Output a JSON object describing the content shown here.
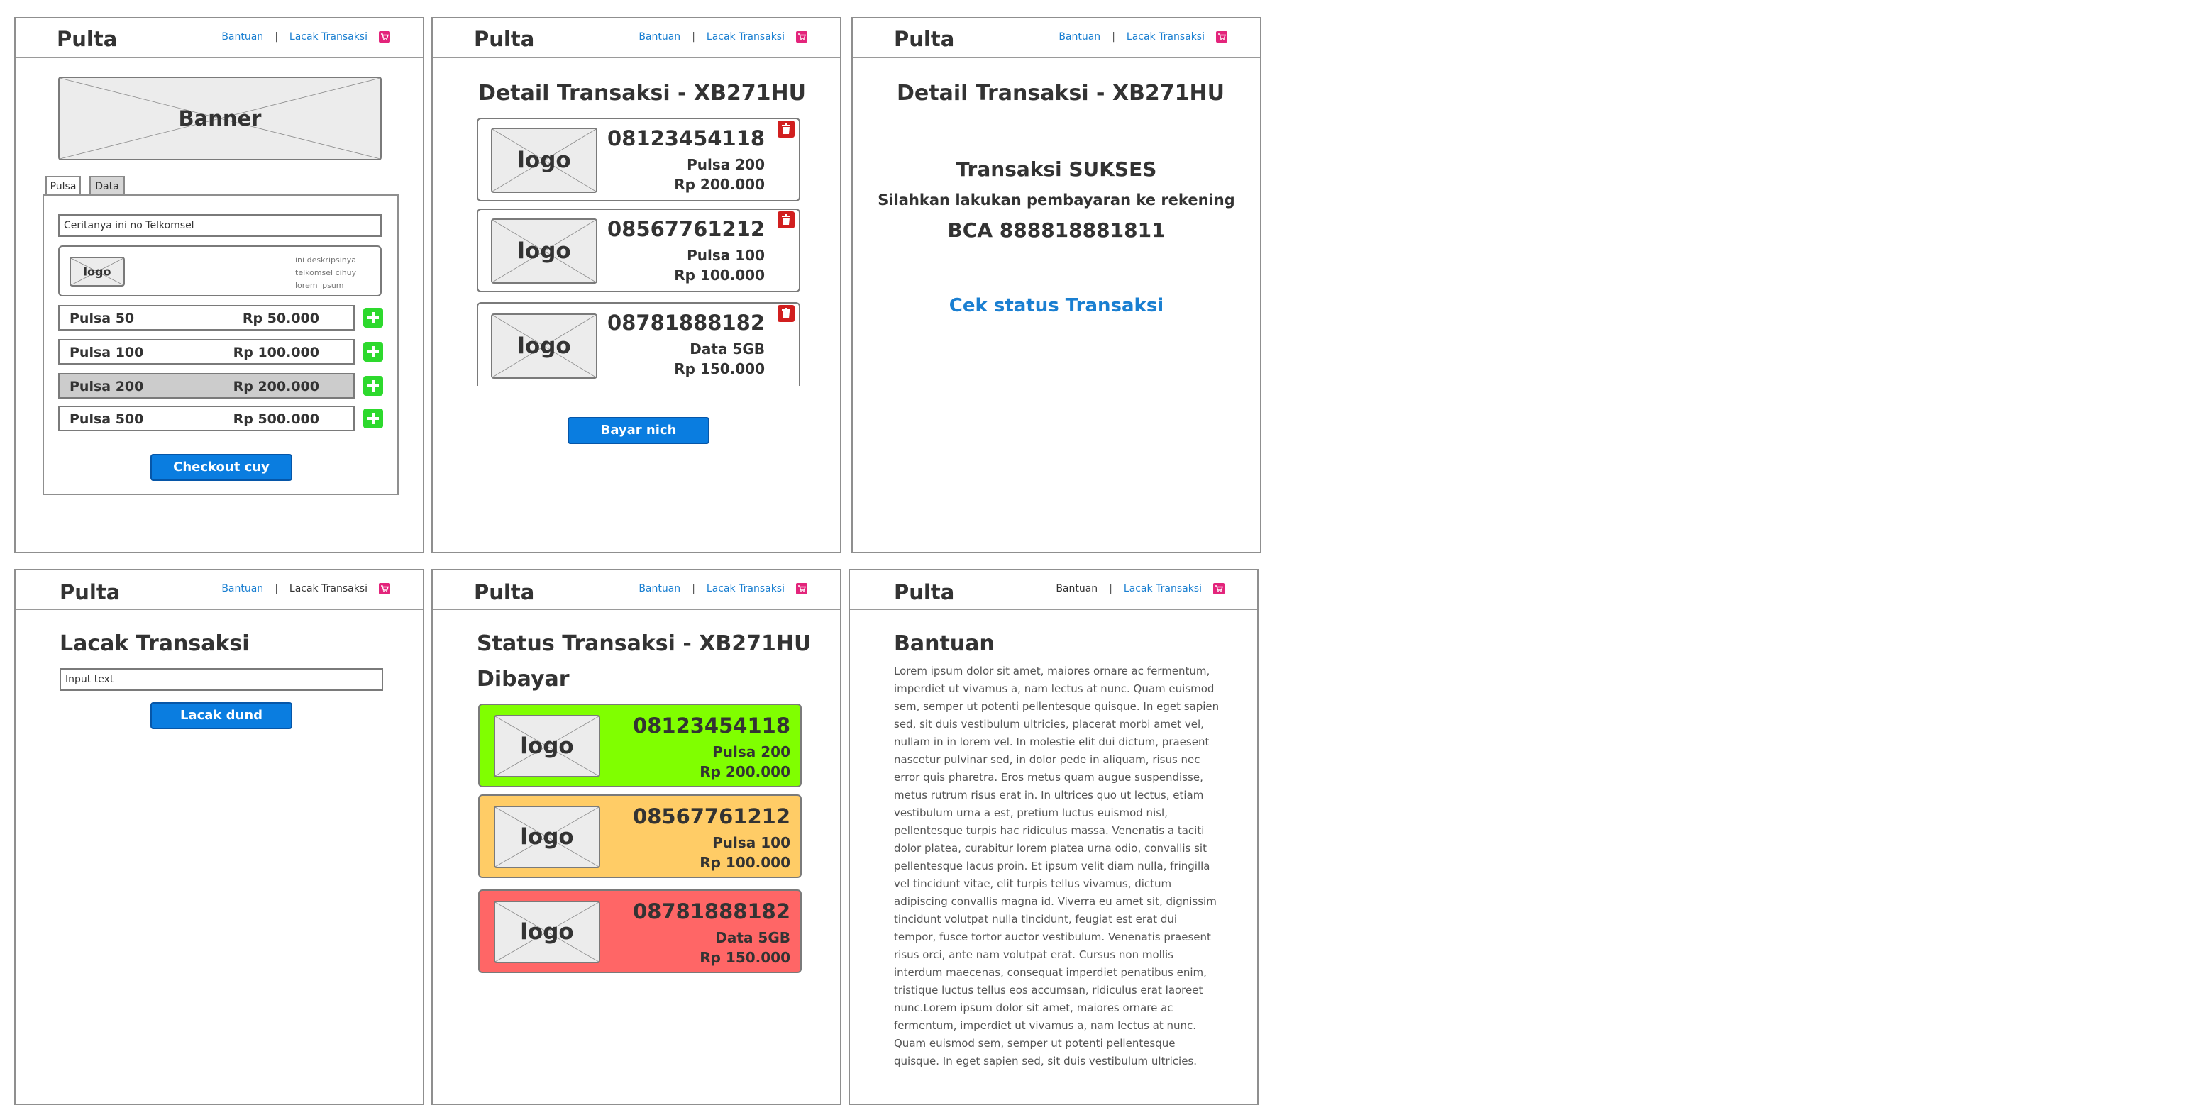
{
  "colors": {
    "link": "#1a7fd1",
    "button": "#0a7de0",
    "cart": "#e3247b",
    "plus": "#2dd92d",
    "trash": "#d11f1f",
    "status_paid": "#80ff00",
    "status_pending": "#ffcc66",
    "status_failed": "#ff6666"
  },
  "header": {
    "brand": "Pulta",
    "help": "Bantuan",
    "separator": "|",
    "track": "Lacak Transaksi",
    "cart_icon": "cart-icon"
  },
  "screen1": {
    "banner": "Banner",
    "tabs": [
      "Pulsa",
      "Data"
    ],
    "phone_value": "Ceritanya ini no Telkomsel",
    "provider_logo": "logo",
    "provider_desc": [
      "ini deskripsinya",
      "telkomsel cihuy",
      "lorem ipsum"
    ],
    "products": [
      {
        "name": "Pulsa 50",
        "price": "Rp 50.000"
      },
      {
        "name": "Pulsa 100",
        "price": "Rp 100.000"
      },
      {
        "name": "Pulsa 200",
        "price": "Rp 200.000"
      },
      {
        "name": "Pulsa 500",
        "price": "Rp 500.000"
      }
    ],
    "checkout": "Checkout cuy"
  },
  "screen2": {
    "title": "Detail Transaksi - XB271HU",
    "items": [
      {
        "logo": "logo",
        "number": "08123454118",
        "product": "Pulsa 200",
        "price": "Rp 200.000"
      },
      {
        "logo": "logo",
        "number": "08567761212",
        "product": "Pulsa 100",
        "price": "Rp 100.000"
      },
      {
        "logo": "logo",
        "number": "08781888182",
        "product": "Data 5GB",
        "price": "Rp 150.000"
      }
    ],
    "pay": "Bayar nich"
  },
  "screen3": {
    "title": "Detail Transaksi - XB271HU",
    "success": "Transaksi SUKSES",
    "instruction": "Silahkan lakukan pembayaran ke rekening",
    "account": "BCA 888818881811",
    "check_status": "Cek status Transaksi"
  },
  "screen4": {
    "title": "Lacak Transaksi",
    "input_placeholder": "Input text",
    "track_button": "Lacak dund"
  },
  "screen5": {
    "title": "Status Transaksi - XB271HU",
    "status": "Dibayar",
    "items": [
      {
        "logo": "logo",
        "number": "08123454118",
        "product": "Pulsa 200",
        "price": "Rp 200.000"
      },
      {
        "logo": "logo",
        "number": "08567761212",
        "product": "Pulsa 100",
        "price": "Rp 100.000"
      },
      {
        "logo": "logo",
        "number": "08781888182",
        "product": "Data 5GB",
        "price": "Rp 150.000"
      }
    ]
  },
  "screen6": {
    "title": "Bantuan",
    "body": "Lorem ipsum dolor sit amet, maiores ornare ac fermentum, imperdiet ut vivamus a, nam lectus at nunc. Quam euismod sem, semper ut potenti pellentesque quisque. In eget sapien sed, sit duis vestibulum ultricies, placerat morbi amet vel, nullam in in lorem vel. In molestie elit dui dictum, praesent nascetur pulvinar sed, in dolor pede in aliquam, risus nec error quis pharetra. Eros metus quam augue suspendisse, metus rutrum risus erat in. In ultrices quo ut lectus, etiam vestibulum urna a est, pretium luctus euismod nisl, pellentesque turpis hac ridiculus massa. Venenatis a taciti dolor platea, curabitur lorem platea urna odio, convallis sit pellentesque lacus proin. Et ipsum velit diam nulla, fringilla vel tincidunt vitae, elit turpis tellus vivamus, dictum adipiscing convallis magna id. Viverra eu amet sit, dignissim tincidunt volutpat nulla tincidunt, feugiat est erat dui tempor, fusce tortor auctor vestibulum. Venenatis praesent risus orci, ante nam volutpat erat. Cursus non mollis interdum maecenas, consequat imperdiet penatibus enim, tristique luctus tellus eos accumsan, ridiculus erat laoreet nunc.Lorem ipsum dolor sit amet, maiores ornare ac fermentum, imperdiet ut vivamus a, nam lectus at nunc. Quam euismod sem, semper ut potenti pellentesque quisque. In eget sapien sed, sit duis vestibulum ultricies."
  }
}
